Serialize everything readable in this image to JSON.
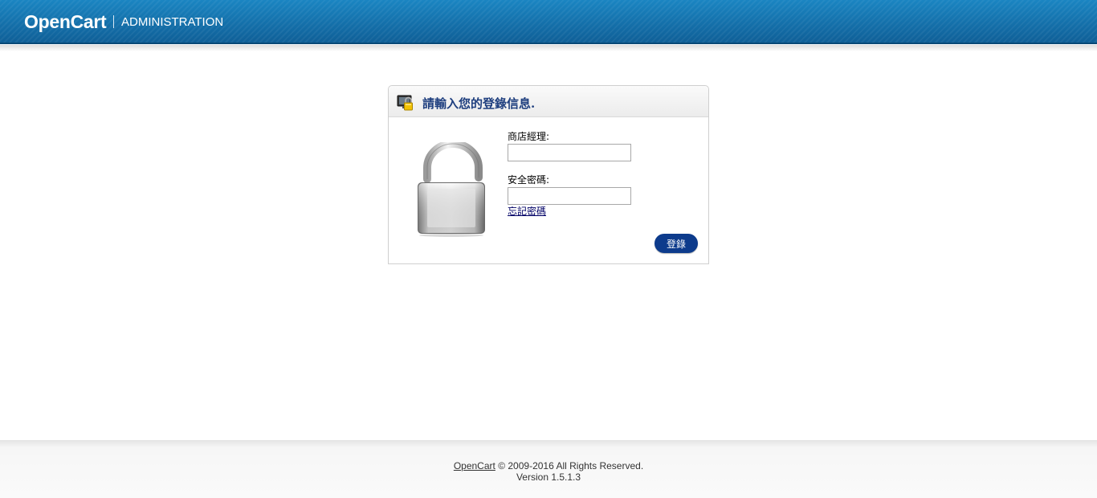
{
  "header": {
    "brand": "OpenCart",
    "subtitle": "ADMINISTRATION"
  },
  "login": {
    "title": "請輸入您的登錄信息.",
    "username_label": "商店經理:",
    "username_value": "",
    "password_label": "安全密碼:",
    "password_value": "",
    "forgot_link": "忘記密碼",
    "submit_label": "登錄",
    "icons": {
      "heading": "lock-screen-icon",
      "main": "padlock-icon"
    }
  },
  "footer": {
    "link_text": "OpenCart",
    "copyright": "© 2009-2016 All Rights Reserved.",
    "version": "Version 1.5.1.3"
  },
  "colors": {
    "header_blue": "#1a85c2",
    "title_blue": "#1f3f7f",
    "button_blue": "#0d3b8c"
  }
}
